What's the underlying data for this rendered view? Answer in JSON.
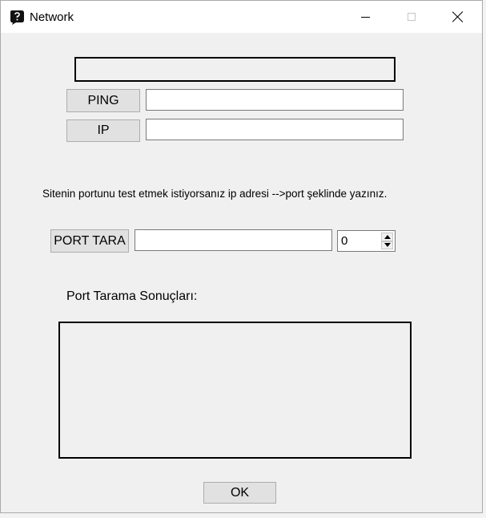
{
  "window": {
    "title": "Network",
    "icon": "app-glyph-icon",
    "controls": {
      "minimize": "minimize-icon",
      "maximize": "maximize-icon",
      "close": "close-icon"
    }
  },
  "display": {
    "value": ""
  },
  "ping": {
    "button_label": "PING",
    "input_value": ""
  },
  "ip": {
    "button_label": "IP",
    "input_value": ""
  },
  "hint_text": "Sitenin portunu test etmek istiyorsanız ip adresi -->port şeklinde yazınız.",
  "port_scan": {
    "button_label": "PORT TARA",
    "input_value": "",
    "spinner_value": "0"
  },
  "results": {
    "label": "Port Tarama Sonuçları:",
    "content": ""
  },
  "ok_button_label": "OK"
}
